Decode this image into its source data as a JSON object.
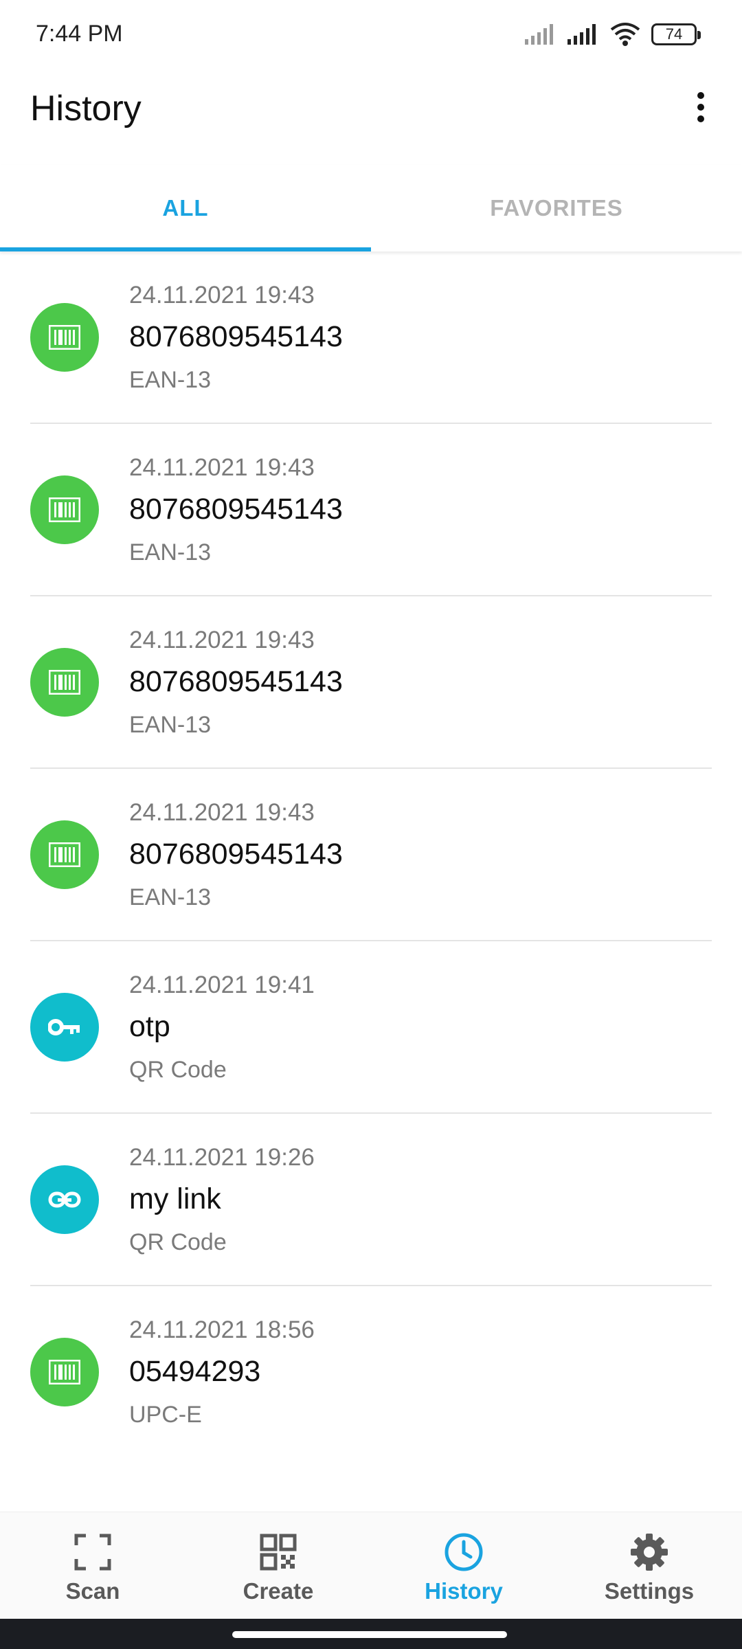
{
  "status_bar": {
    "time": "7:44 PM",
    "battery": "74",
    "icons": [
      "signal-icon",
      "signal-icon",
      "wifi-icon",
      "battery-icon"
    ]
  },
  "header": {
    "title": "History",
    "menu_icon": "more-vertical-icon"
  },
  "tabs": [
    {
      "label": "ALL",
      "active": true
    },
    {
      "label": "FAVORITES",
      "active": false
    }
  ],
  "colors": {
    "accent": "#1aa3e0",
    "barcode_green": "#4cc84a",
    "qr_teal": "#10bdcc"
  },
  "history": [
    {
      "date": "24.11.2021 19:43",
      "value": "8076809545143",
      "format": "EAN-13",
      "icon": "barcode-icon"
    },
    {
      "date": "24.11.2021 19:43",
      "value": "8076809545143",
      "format": "EAN-13",
      "icon": "barcode-icon"
    },
    {
      "date": "24.11.2021 19:43",
      "value": "8076809545143",
      "format": "EAN-13",
      "icon": "barcode-icon"
    },
    {
      "date": "24.11.2021 19:43",
      "value": "8076809545143",
      "format": "EAN-13",
      "icon": "barcode-icon"
    },
    {
      "date": "24.11.2021 19:41",
      "value": "otp",
      "format": "QR Code",
      "icon": "key-icon"
    },
    {
      "date": "24.11.2021 19:26",
      "value": "my link",
      "format": "QR Code",
      "icon": "link-icon"
    },
    {
      "date": "24.11.2021 18:56",
      "value": "05494293",
      "format": "UPC-E",
      "icon": "barcode-icon"
    }
  ],
  "bottom_nav": [
    {
      "label": "Scan",
      "icon": "scan-frame-icon",
      "active": false
    },
    {
      "label": "Create",
      "icon": "qr-code-icon",
      "active": false
    },
    {
      "label": "History",
      "icon": "clock-icon",
      "active": true
    },
    {
      "label": "Settings",
      "icon": "gear-icon",
      "active": false
    }
  ]
}
